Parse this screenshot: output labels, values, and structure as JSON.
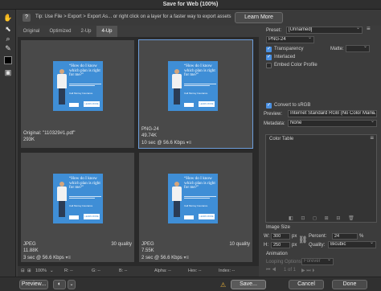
{
  "window": {
    "title": "Save for Web (100%)"
  },
  "tipbar": {
    "icon": "lightbulb-icon",
    "text": "Tip: Use File > Export > Export As... or right click on a layer for a faster way to export assets",
    "text_display": "Tip: Use File > Export > Export As...  or right click on a layer for a faster way to export assets",
    "learn_more": "Learn More"
  },
  "tabs": [
    "Original",
    "Optimized",
    "2-Up",
    "4-Up"
  ],
  "active_tab": "4-Up",
  "thumb": {
    "headline": "“How do I know which plan is right for me?”",
    "brand": "Call Murray Insurance",
    "cta": "LEARN MORE"
  },
  "panes": [
    {
      "line1": "Original: \"110329#1.pdf\"",
      "line2": "293K",
      "line3": "",
      "quality": ""
    },
    {
      "line1": "PNG-24",
      "line2": "49.74K",
      "line3": "10 sec @ 56.6 Kbps",
      "quality": ""
    },
    {
      "line1": "JPEG",
      "line2": "11.88K",
      "line3": "3 sec @ 56.6 Kbps",
      "quality": "30 quality"
    },
    {
      "line1": "JPEG",
      "line2": "7.55K",
      "line3": "2 sec @ 56.6 Kbps",
      "quality": "10 quality"
    }
  ],
  "bottom_bar": {
    "zoom": "100%",
    "r": "R: --",
    "g": "G: --",
    "b": "B: --",
    "alpha": "Alpha: --",
    "hex": "Hex: --",
    "index": "Index: --"
  },
  "footer": {
    "preview": "Preview...",
    "save": "Save...",
    "cancel": "Cancel",
    "done": "Done"
  },
  "settings": {
    "preset_label": "Preset:",
    "preset_value": "[Unnamed]",
    "format": "PNG-24",
    "transparency": "Transparency",
    "matte_label": "Matte:",
    "interlaced": "Interlaced",
    "embed_color_profile": "Embed Color Profile",
    "convert_srgb": "Convert to sRGB",
    "preview_label": "Preview:",
    "preview_value": "Internet Standard RGB (No Color Mana...",
    "metadata_label": "Metadata:",
    "metadata_value": "None",
    "color_table": "Color Table",
    "image_size": "Image Size",
    "w_label": "W:",
    "w_value": "300",
    "h_label": "H:",
    "h_value": "250",
    "unit": "px",
    "percent_label": "Percent:",
    "percent_value": "24",
    "percent_unit": "%",
    "quality_label": "Quality:",
    "quality_value": "Bicubic",
    "animation": "Animation",
    "looping_label": "Looping Options:",
    "looping_value": "Forever",
    "frame": "1 of 1"
  }
}
